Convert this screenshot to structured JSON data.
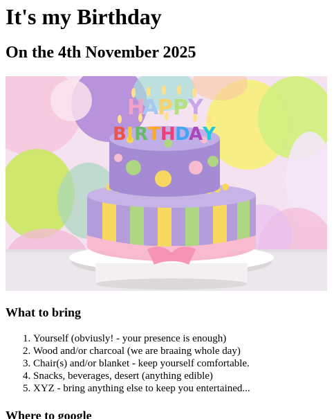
{
  "page": {
    "title": "It's my Birthday",
    "subtitle": "On the 4th November 2025"
  },
  "hero_image": {
    "icon": "birthday-cake-image",
    "caption_on_image_line1": "HAPPY",
    "caption_on_image_line2": "BIRTHDAY",
    "colors": {
      "cake_lavender": "#b39ddb",
      "cake_pink": "#f8bbd0",
      "stripe_yellow": "#f6d860",
      "stripe_green": "#aed581"
    }
  },
  "bring": {
    "heading": "What to bring",
    "items": [
      "Yourself (obviusly! - your presence is enough)",
      "Wood and/or charcoal (we are braaing whole day)",
      "Chair(s) and/or blanket - keep yourself comfortable.",
      "Snacks, beverages, desert (anything edible)",
      "XYZ - bring anything else to keep you entertained..."
    ]
  },
  "google": {
    "heading": "Where to google"
  }
}
